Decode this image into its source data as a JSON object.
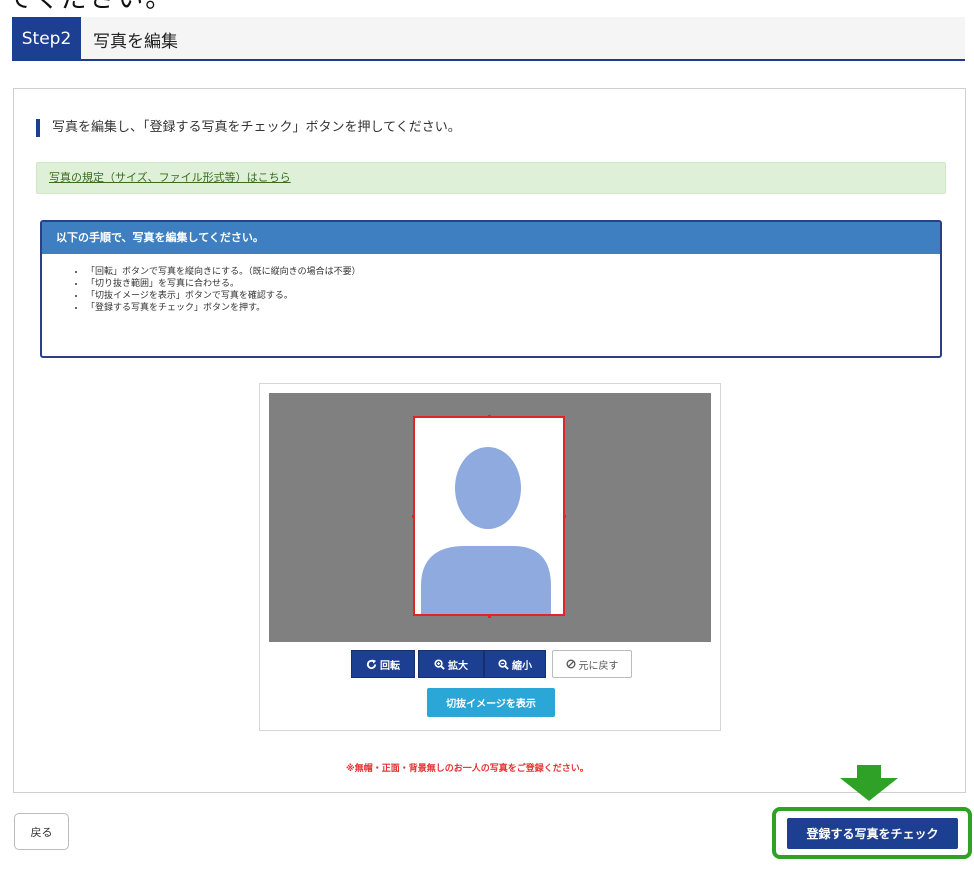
{
  "top_clip_text": "てください。",
  "step": {
    "badge": "Step2",
    "title": "写真を編集"
  },
  "instruction": "写真を編集し、「登録する写真をチェック」ボタンを押してください。",
  "photo_rules_link": "写真の規定（サイズ、ファイル形式等）はこちら",
  "steps_box": {
    "title": "以下の手順で、写真を編集してください。",
    "items": [
      "「回転」ボタンで写真を縦向きにする。（既に縦向きの場合は不要）",
      "「切り抜き範囲」を写真に合わせる。",
      "「切抜イメージを表示」ボタンで写真を確認する。",
      "「登録する写真をチェック」ボタンを押す。"
    ]
  },
  "editor": {
    "buttons": {
      "rotate": "回転",
      "zoom_in": "拡大",
      "zoom_out": "縮小",
      "reset": "元に戻す",
      "preview": "切抜イメージを表示"
    },
    "colors": {
      "canvas_bg": "#808080",
      "crop_border": "#e0252a",
      "silhouette": "#8eaadf"
    }
  },
  "warning": "※無帽・正面・背景無しのお一人の写真をご登録ください。",
  "back_button": "戻る",
  "submit_button": "登録する写真をチェック",
  "colors": {
    "primary": "#1d3f91",
    "info": "#2aa7d6",
    "highlight": "#2fa127",
    "warning": "#e53030"
  }
}
